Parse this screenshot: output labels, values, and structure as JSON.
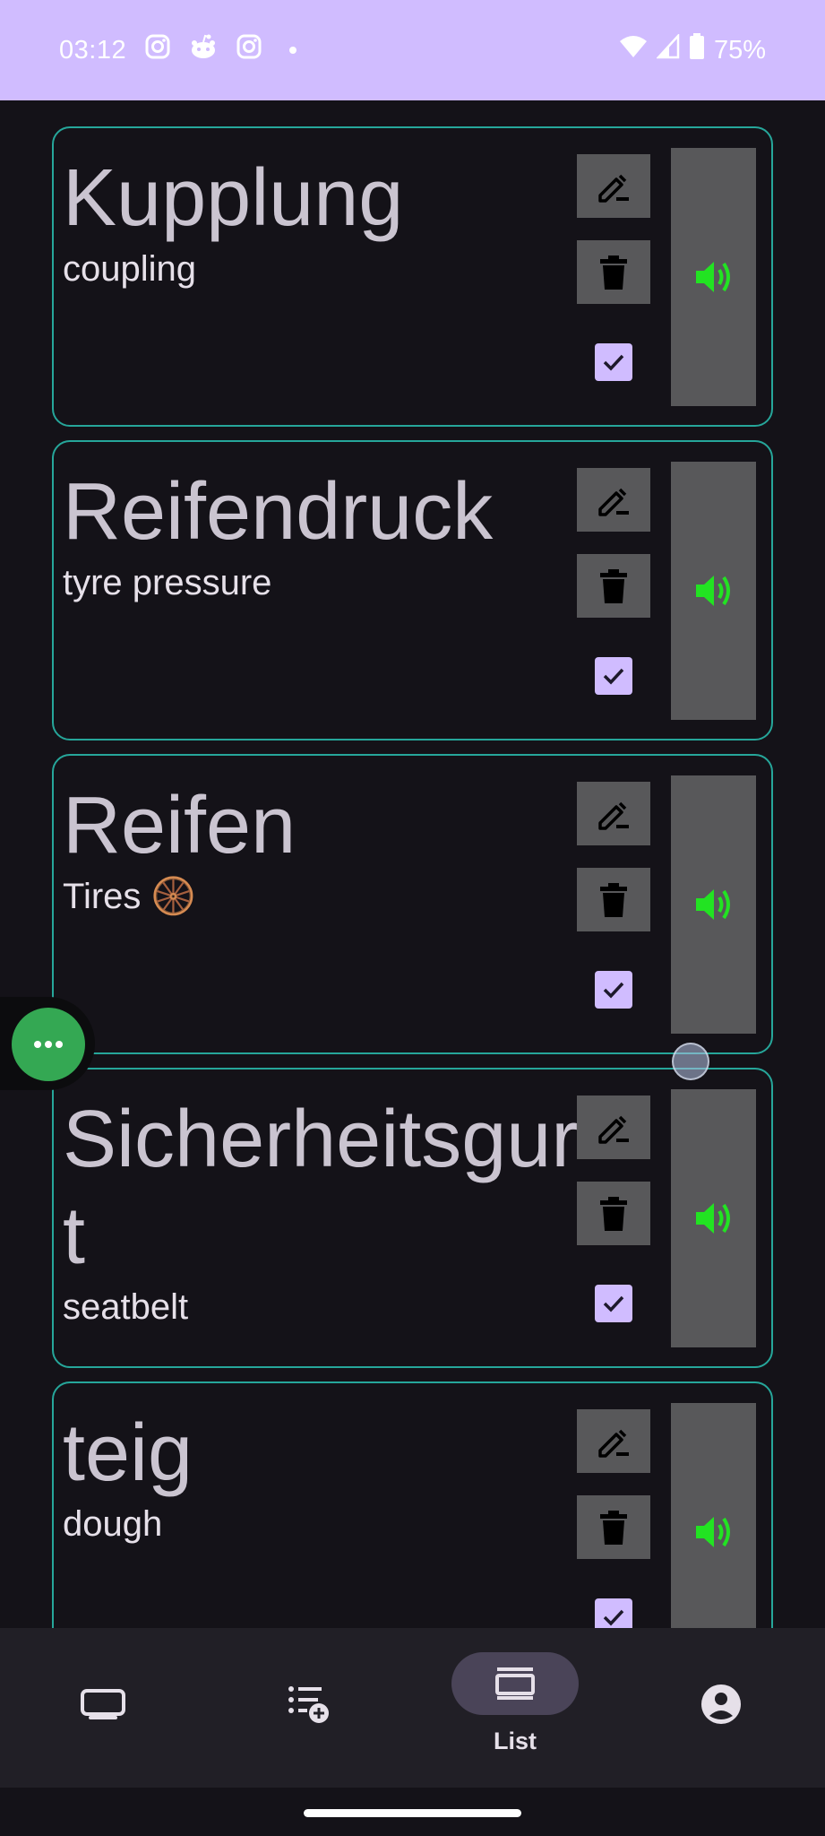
{
  "status_bar": {
    "time": "03:12",
    "notification_icons": [
      "instagram-icon",
      "reddit-icon",
      "instagram-icon",
      "more-dot-icon"
    ],
    "battery": "75%",
    "background_color": "#d0bcff"
  },
  "words": [
    {
      "word": "Kupplung",
      "translation": "coupling",
      "checked": true
    },
    {
      "word": "Reifendruck",
      "translation": "tyre pressure",
      "checked": true
    },
    {
      "word": "Reifen",
      "translation": "Tires 🛞",
      "checked": true
    },
    {
      "word": "Sicherheitsgurt",
      "translation": "seatbelt",
      "checked": true
    },
    {
      "word": "teig",
      "translation": "dough",
      "checked": true
    }
  ],
  "bottom_nav": {
    "items": [
      {
        "icon": "cards-icon",
        "label": ""
      },
      {
        "icon": "add-list-icon",
        "label": ""
      },
      {
        "icon": "list-icon",
        "label": "List",
        "active": true
      },
      {
        "icon": "account-icon",
        "label": ""
      }
    ]
  },
  "colors": {
    "card_border": "#26a69a",
    "speaker_icon": "#22e322",
    "checkbox": "#d0bcff",
    "floating_button": "#34a853"
  }
}
